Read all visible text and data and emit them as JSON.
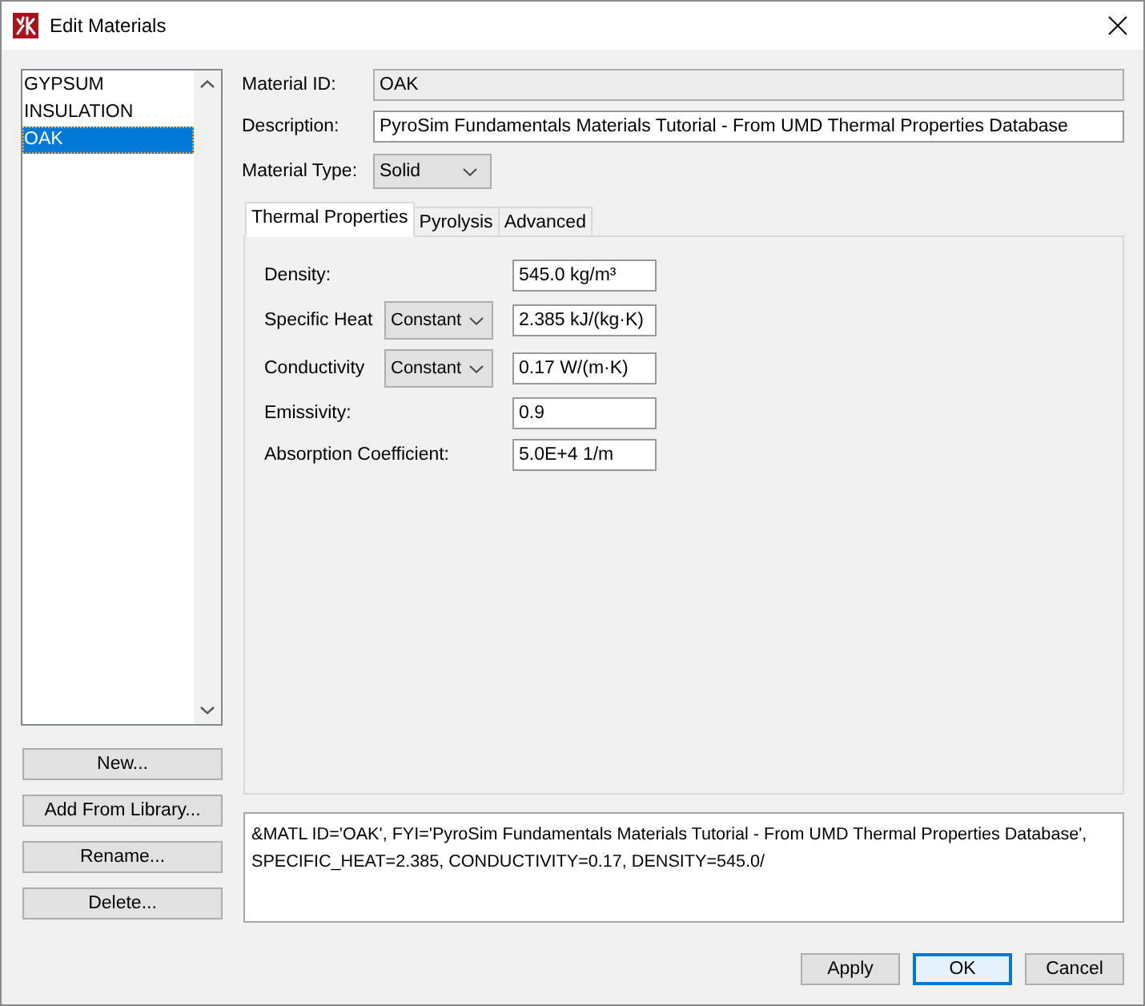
{
  "window": {
    "title": "Edit Materials"
  },
  "material_list": [
    {
      "label": "GYPSUM",
      "selected": false
    },
    {
      "label": "INSULATION",
      "selected": false
    },
    {
      "label": "OAK",
      "selected": true
    }
  ],
  "material_buttons": [
    "New...",
    "Add From Library...",
    "Rename...",
    "Delete..."
  ],
  "fields": [
    {
      "label": "Material ID:",
      "value": "OAK",
      "readonly": true
    },
    {
      "label": "Description:",
      "value": "PyroSim Fundamentals Materials Tutorial - From UMD Thermal Properties Database",
      "readonly": false
    }
  ],
  "material_type": {
    "label": "Material Type:",
    "value": "Solid"
  },
  "tabs": [
    {
      "label": "Thermal Properties",
      "selected": true
    },
    {
      "label": "Pyrolysis",
      "selected": false
    },
    {
      "label": "Advanced",
      "selected": false
    }
  ],
  "properties": [
    {
      "kind": "field",
      "label": "Density:",
      "value": "545.0 kg/m³"
    },
    {
      "kind": "dropdown_field",
      "label": "Specific Heat",
      "mode": "Constant",
      "value": "2.385 kJ/(kg·K)"
    },
    {
      "kind": "dropdown_field",
      "label": "Conductivity",
      "mode": "Constant",
      "value": "0.17 W/(m·K)"
    },
    {
      "kind": "field",
      "label": "Emissivity:",
      "value": "0.9"
    },
    {
      "kind": "field",
      "label": "Absorption Coefficient:",
      "value": "5.0E+4 1/m"
    }
  ],
  "fds_text": "&MATL ID='OAK', FYI='PyroSim Fundamentals Materials Tutorial - From UMD Thermal Properties Database',\nSPECIFIC_HEAT=2.385, CONDUCTIVITY=0.17, DENSITY=545.0/",
  "dialog_buttons": [
    {
      "label": "Apply",
      "focused": false
    },
    {
      "label": "OK",
      "focused": true
    },
    {
      "label": "Cancel",
      "focused": false
    }
  ]
}
